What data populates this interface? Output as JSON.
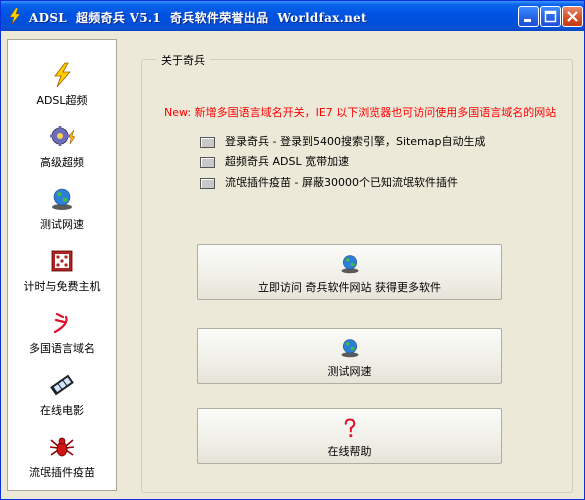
{
  "window": {
    "title": "ADSL  超频奇兵 V5.1  奇兵软件荣誉出品  Worldfax.net"
  },
  "sidebar": {
    "items": [
      {
        "label": "ADSL超频",
        "icon": "lightning-icon"
      },
      {
        "label": "高级超频",
        "icon": "gear-icon"
      },
      {
        "label": "测试网速",
        "icon": "globe-icon"
      },
      {
        "label": "计时与免费主机",
        "icon": "dice-icon"
      },
      {
        "label": "多国语言域名",
        "icon": "multilang-icon"
      },
      {
        "label": "在线电影",
        "icon": "film-icon"
      },
      {
        "label": "流氓插件疫苗",
        "icon": "spider-icon"
      }
    ]
  },
  "group": {
    "legend": "关于奇兵",
    "notice": "New: 新增多国语言域名开关，IE7 以下浏览器也可访问使用多国语言域名的网站",
    "options": [
      "登录奇兵 - 登录到5400搜索引擎，Sitemap自动生成",
      "超频奇兵 ADSL 宽带加速",
      "流氓插件疫苗 - 屏蔽30000个已知流氓软件插件"
    ],
    "buttons": [
      {
        "label": "立即访问  奇兵软件网站 获得更多软件",
        "icon": "globe-icon"
      },
      {
        "label": "测试网速",
        "icon": "globe-icon"
      },
      {
        "label": "在线帮助",
        "icon": "question-icon"
      }
    ]
  }
}
